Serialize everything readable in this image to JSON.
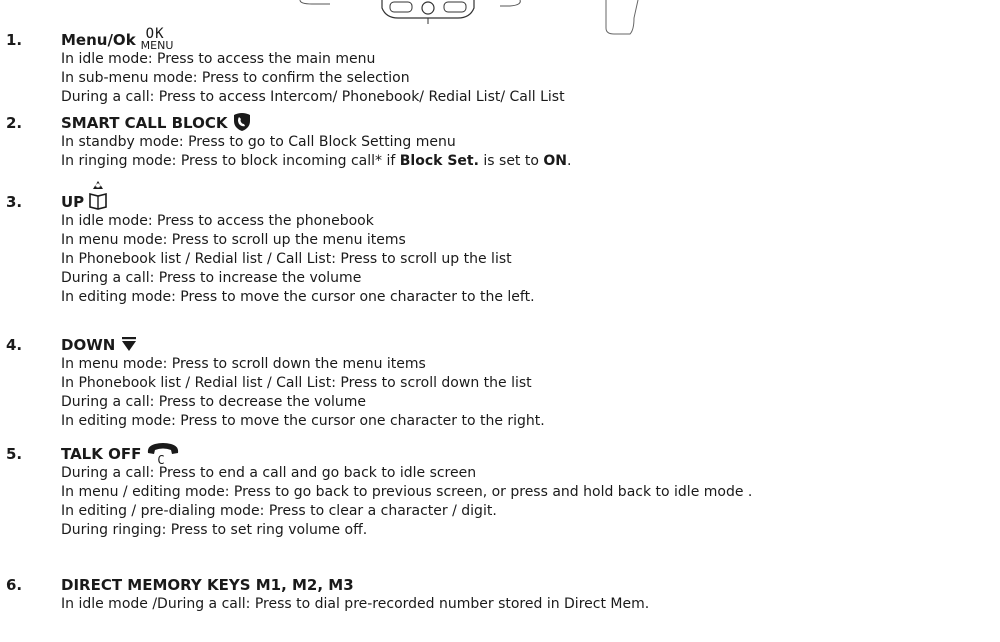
{
  "items": [
    {
      "number": "1.",
      "title": "Menu/Ok",
      "icon_top": "OK",
      "icon_bottom": "MENU",
      "icon": "ok-menu-icon",
      "lines": [
        "In idle mode: Press to access the main menu",
        "In sub-menu mode: Press to confirm the selection",
        "During a call: Press to access Intercom/ Phonebook/ Redial List/ Call List"
      ]
    },
    {
      "number": "2.",
      "title": "SMART CALL BLOCK",
      "icon": "shield-phone-icon",
      "lines": [
        "In standby mode: Press to go to Call Block Setting menu"
      ],
      "line2": {
        "pre": "In ringing mode: Press to block incoming call* if ",
        "bold1": "Block Set.",
        "mid": " is set to ",
        "bold2": "ON",
        "post": "."
      }
    },
    {
      "number": "3.",
      "title": "UP",
      "icon": "phonebook-up-icon",
      "lines": [
        "In idle mode: Press to access the phonebook",
        "In menu mode: Press to scroll up the menu items",
        "In Phonebook list / Redial list / Call List: Press to scroll up the list",
        "During a call: Press to increase the volume",
        "In editing mode: Press to move the cursor one character to the left."
      ]
    },
    {
      "number": "4.",
      "title": "DOWN",
      "icon": "down-triangle-icon",
      "lines": [
        "In menu mode: Press to scroll down the menu items",
        "In Phonebook list / Redial list / Call List: Press to scroll down the list",
        "During a call: Press to decrease the volume",
        "In editing mode: Press to move the cursor one character to the right."
      ]
    },
    {
      "number": "5.",
      "title": "TALK OFF",
      "icon": "hang-up-c-icon",
      "icon_letter": "C",
      "lines": [
        "During a call: Press to end a call and go back to idle screen",
        "In menu / editing mode: Press to go back to previous screen, or press and hold back to idle mode .",
        "In editing / pre-dialing mode: Press to clear a character / digit.",
        "During ringing: Press to set ring volume off."
      ]
    },
    {
      "number": "6.",
      "title": "DIRECT MEMORY KEYS M1, M2, M3",
      "lines": [
        "In idle mode /During a call: Press to dial pre-recorded number stored in Direct Mem."
      ]
    }
  ]
}
